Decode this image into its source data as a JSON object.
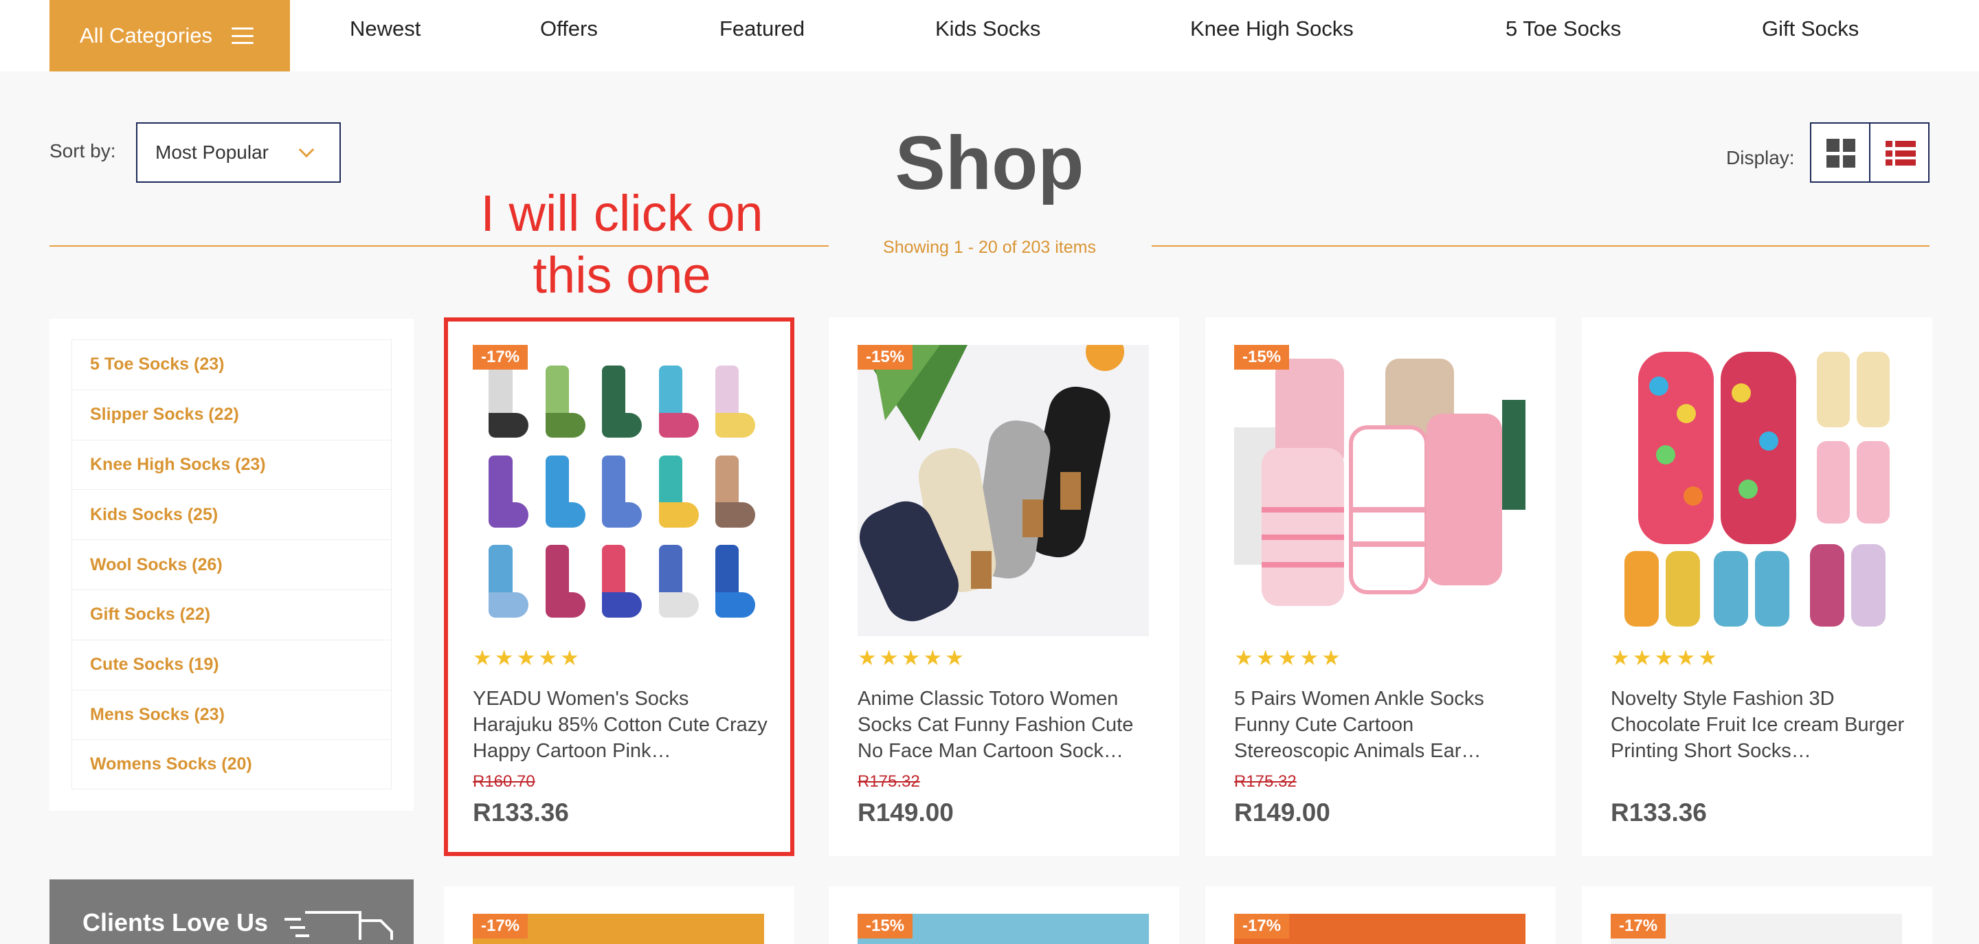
{
  "nav": {
    "all_categories": "All Categories",
    "links": [
      "Newest",
      "Offers",
      "Featured",
      "Kids Socks",
      "Knee High Socks",
      "5 Toe Socks",
      "Gift Socks"
    ]
  },
  "toolbar": {
    "sort_label": "Sort by:",
    "sort_value": "Most Popular",
    "title": "Shop",
    "showing": "Showing 1 - 20 of 203 items",
    "display_label": "Display:"
  },
  "annotation": {
    "line1": "I will click on",
    "line2": "this one"
  },
  "sidebar": {
    "categories": [
      "5 Toe Socks (23)",
      "Slipper Socks (22)",
      "Knee High Socks (23)",
      "Kids Socks (25)",
      "Wool Socks (26)",
      "Gift Socks (22)",
      "Cute Socks (19)",
      "Mens Socks (23)",
      "Womens Socks (20)"
    ],
    "clients_banner": "Clients Love Us"
  },
  "products": [
    {
      "badge": "-17%",
      "stars": "★★★★★",
      "name": "YEADU Women's Socks Harajuku 85% Cotton Cute Crazy Happy Cartoon Pink…",
      "old_price": "R160.70",
      "price": "R133.36",
      "rating": 5
    },
    {
      "badge": "-15%",
      "stars": "★★★★★",
      "name": "Anime Classic Totoro Women Socks Cat Funny Fashion Cute No Face Man Cartoon Sock…",
      "old_price": "R175.32",
      "price": "R149.00",
      "rating": 5
    },
    {
      "badge": "-15%",
      "stars": "★★★★★",
      "name": "5 Pairs Women Ankle Socks Funny Cute Cartoon Stereoscopic Animals Ear…",
      "old_price": "R175.32",
      "price": "R149.00",
      "rating": 5
    },
    {
      "badge": "",
      "stars": "★★★★★",
      "name": "Novelty Style Fashion 3D Chocolate Fruit Ice cream Burger Printing Short Socks…",
      "old_price": "",
      "price": "R133.36",
      "rating": 4.5
    }
  ],
  "row2_badges": [
    "-17%",
    "-15%",
    "-17%",
    "-17%"
  ],
  "colors": {
    "accent": "#e5a03e",
    "badge": "#ef7d32",
    "annotation": "#e8322b",
    "navy": "#1e2a58",
    "strike_price": "#c0262c"
  }
}
